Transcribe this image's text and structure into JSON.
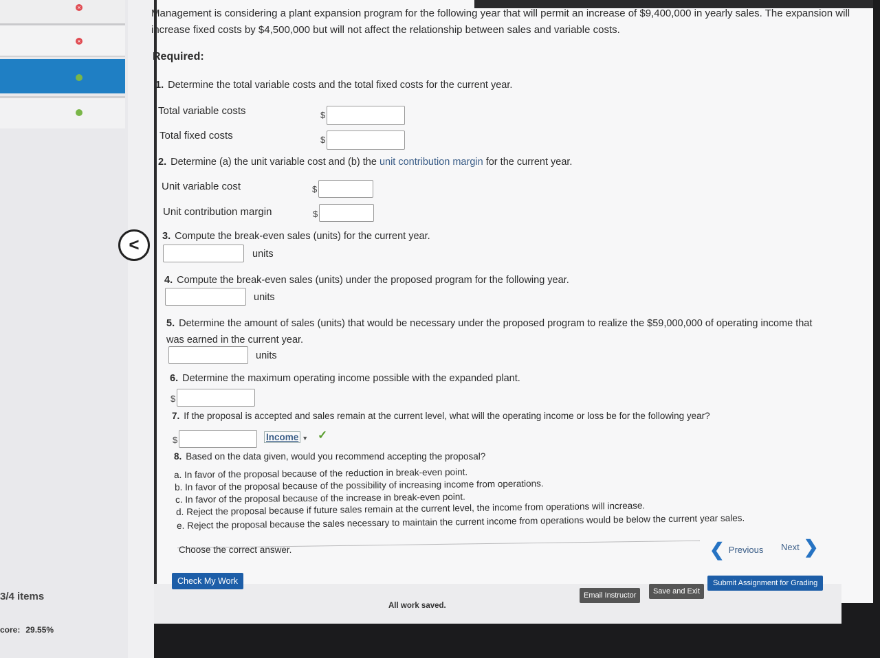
{
  "sidebar": {
    "items_count": "3/4 items",
    "score_label": "core:",
    "score_value": "29.55%"
  },
  "problem": {
    "intro": "Management is considering a plant expansion program for the following year that will permit an increase of $9,400,000 in yearly sales. The expansion will increase fixed costs by $4,500,000 but will not affect the relationship between sales and variable costs.",
    "required": "Required:"
  },
  "questions": {
    "q1": {
      "num": "1.",
      "text": "Determine the total variable costs and the total fixed costs for the current year.",
      "label_a": "Total variable costs",
      "label_b": "Total fixed costs"
    },
    "q2": {
      "num": "2.",
      "text_a": "Determine (a) the unit variable cost and (b) the",
      "text_link": "unit contribution margin",
      "text_b": "for the current year.",
      "label_a": "Unit variable cost",
      "label_b": "Unit contribution margin"
    },
    "q3": {
      "num": "3.",
      "text": "Compute the break-even sales (units) for the current year."
    },
    "q4": {
      "num": "4.",
      "text": "Compute the break-even sales (units) under the proposed program for the following year."
    },
    "q5": {
      "num": "5.",
      "text": "Determine the amount of sales (units) that would be necessary under the proposed program to realize the $59,000,000 of operating income that was earned in the current year."
    },
    "q6": {
      "num": "6.",
      "text": "Determine the maximum operating income possible with the expanded plant."
    },
    "q7": {
      "num": "7.",
      "text": "If the proposal is accepted and sales remain at the current level, what will the operating income or loss be for the following year?",
      "dropdown_value": "Income"
    },
    "q8": {
      "num": "8.",
      "text": "Based on the data given, would you recommend accepting the proposal?",
      "options": [
        {
          "letter": "a.",
          "text": "In favor of the proposal because of the reduction in break-even point."
        },
        {
          "letter": "b.",
          "text": "In favor of the proposal because of the possibility of increasing income from operations."
        },
        {
          "letter": "c.",
          "text": "In favor of the proposal because of the increase in break-even point."
        },
        {
          "letter": "d.",
          "text": "Reject the proposal because if future sales remain at the current level, the income from operations will increase."
        },
        {
          "letter": "e.",
          "text": "Reject the proposal because the sales necessary to maintain the current income from operations would be below the current year sales."
        }
      ],
      "choose": "Choose the correct answer."
    }
  },
  "common": {
    "dollar": "$",
    "units": "units",
    "check": "✓",
    "back": "<"
  },
  "nav": {
    "previous": "Previous",
    "next": "Next",
    "prev_arrow": "❮",
    "next_arrow": "❯"
  },
  "footer": {
    "check_my_work": "Check My Work",
    "all_work_saved": "All work saved.",
    "email_instructor": "Email Instructor",
    "save_and_exit": "Save and Exit",
    "submit": "Submit Assignment for Grading"
  }
}
